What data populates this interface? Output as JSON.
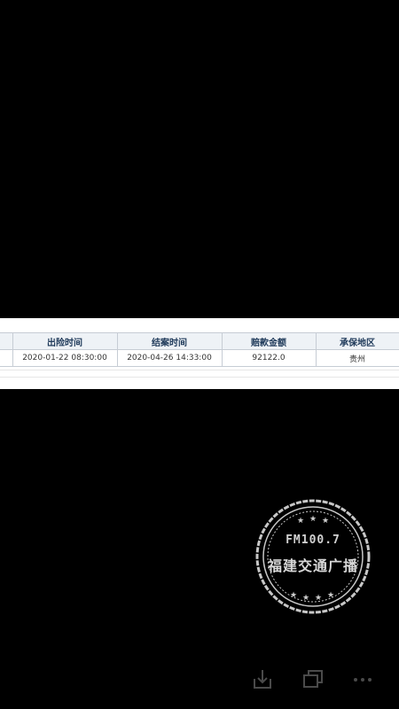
{
  "table": {
    "headers": [
      "",
      "出险时间",
      "结案时间",
      "赔款金额",
      "承保地区"
    ],
    "rows": [
      [
        "",
        "2020-01-22 08:30:00",
        "2020-04-26 14:33:00",
        "92122.0",
        "贵州"
      ]
    ]
  },
  "watermark": {
    "line1": "FM100.7",
    "line2": "福建交通广播"
  },
  "toolbar": {
    "icons": [
      "download-icon",
      "multi-window-icon",
      "more-icon"
    ]
  },
  "colors": {
    "background": "#000000",
    "header_bg": "#eef2f6",
    "header_text": "#1f3a5a",
    "border": "#c6ccd4",
    "icon_gray": "#4a4a4a"
  }
}
